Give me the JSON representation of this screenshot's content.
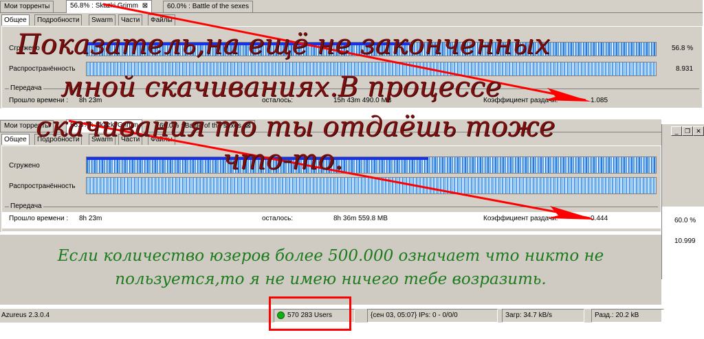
{
  "top_window": {
    "tabs": [
      {
        "label": "Мои торренты"
      },
      {
        "label": "56.8% : Skazki Grimm"
      },
      {
        "label": "60.0% : Battle of the sexes"
      }
    ],
    "subtabs": [
      "Общее",
      "Подробности",
      "Swarm",
      "Части",
      "Файлы"
    ],
    "downloaded_label": "Сгружено",
    "downloaded_value": "56.8 %",
    "downloaded_fraction": 0.568,
    "availability_label": "Распространённость",
    "availability_value": "8.931",
    "transfer_label": "Передача",
    "elapsed_label": "Прошло времени :",
    "elapsed_value": "8h 23m",
    "remaining_label": "осталось:",
    "remaining_value": "15h 43m 490.0 MB",
    "ratio_label": "Коэффициент раздачи:",
    "ratio_value": "1.085"
  },
  "bottom_window": {
    "tabs": [
      {
        "label": "Мои торренты"
      },
      {
        "label": "56.8% : Skazki Grimm"
      },
      {
        "label": "60.0% : Battle of the sexes"
      }
    ],
    "subtabs": [
      "Общее",
      "Подробности",
      "Swarm",
      "Части",
      "Файлы"
    ],
    "downloaded_label": "Сгружено",
    "downloaded_fraction": 0.6,
    "availability_label": "Распространённость",
    "transfer_label": "Передача",
    "elapsed_label": "Прошло времени :",
    "elapsed_value": "8h 23m",
    "remaining_label": "осталось:",
    "remaining_value": "8h 36m 559.8 MB",
    "ratio_label": "Коэффициент раздачи:",
    "ratio_value": "0.444"
  },
  "right_window": {
    "downloaded_value": "60.0 %",
    "availability_value": "10.999",
    "buttons": [
      "_",
      "❐",
      "✕"
    ]
  },
  "annotations": {
    "red_line1": "Показатель,на ещё не законченных",
    "red_line2": "мной скачиваниях.В процессе",
    "red_line3": "скачивания то ты отдаёшь тоже",
    "red_line4": "что-то.",
    "green_line1": "Если количество юзеров более 500.000 означает что никто не",
    "green_line2": "пользуется,то я не имею ничего тебе возразить."
  },
  "statusbar": {
    "version": "Azureus 2.3.0.4",
    "users": "570 283 Users",
    "status_info": "{сен 03, 05:07} IPs: 0 - 0/0/0",
    "download_speed": "Загр: 34.7 kB/s",
    "upload_speed": "Разд.: 20.2 kB"
  },
  "colors": {
    "annotation_red": "#7a0f0f",
    "arrow_red": "#ff0000",
    "annotation_green": "#1c7a1c",
    "progress_blue": "#1a2fe8",
    "status_ok": "#10b010"
  }
}
